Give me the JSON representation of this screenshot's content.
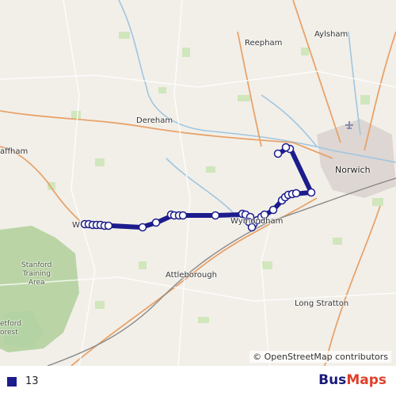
{
  "map": {
    "places": {
      "aylsham": "Aylsham",
      "reepham": "Reepham",
      "dereham": "Dereham",
      "norwich": "Norwich",
      "swaffham": "affham",
      "watton": "W",
      "wymondham": "Wymondham",
      "attleborough": "Attleborough",
      "long_stratton": "Long Stratton",
      "stanford": "Stanford\nTraining\nArea",
      "thetford_forest": "etford\norest"
    },
    "attribution": "© OpenStreetMap contributors"
  },
  "route": {
    "color": "#1c1c8c"
  },
  "legend": {
    "swatch_color": "#1c1c8c",
    "label": "13"
  },
  "brand": {
    "part1": "Bus",
    "part2": "Maps"
  }
}
